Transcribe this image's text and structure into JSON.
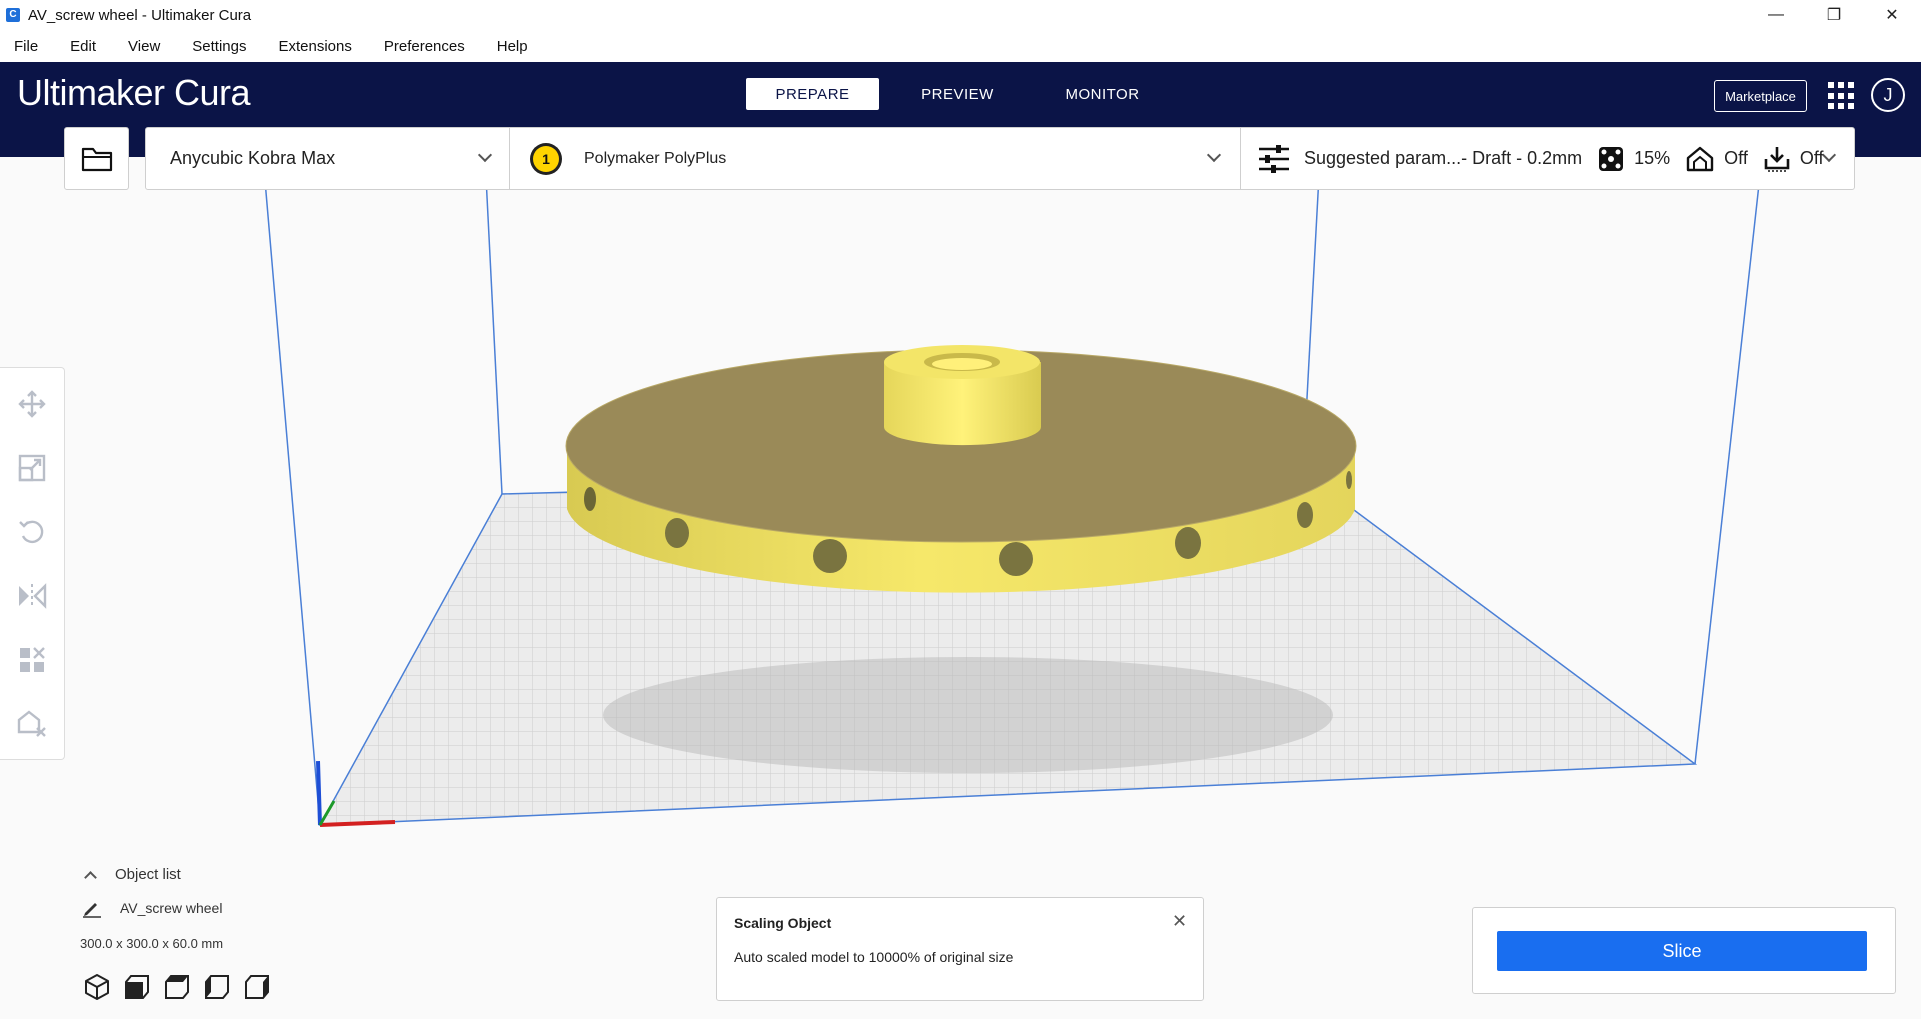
{
  "window": {
    "title": "AV_screw wheel - Ultimaker Cura",
    "app_icon_glyph": "C",
    "controls": {
      "minimize": "—",
      "maximize": "❐",
      "close": "✕"
    }
  },
  "menu": [
    "File",
    "Edit",
    "View",
    "Settings",
    "Extensions",
    "Preferences",
    "Help"
  ],
  "header": {
    "logo_bold": "Ultimaker",
    "logo_light": "Cura",
    "tabs": [
      {
        "label": "PREPARE",
        "active": true
      },
      {
        "label": "PREVIEW",
        "active": false
      },
      {
        "label": "MONITOR",
        "active": false
      }
    ],
    "marketplace": "Marketplace",
    "account_initial": "J"
  },
  "toolbar": {
    "printer": "Anycubic Kobra Max",
    "extruder_number": "1",
    "material": "Polymaker PolyPlus",
    "profile": "Suggested param...- Draft - 0.2mm",
    "infill": "15%",
    "support": "Off",
    "adhesion": "Off"
  },
  "object_list": {
    "toggle_label": "Object list",
    "object_name": "AV_screw wheel",
    "dimensions": "300.0 x 300.0 x 60.0 mm"
  },
  "message": {
    "title": "Scaling Object",
    "body": "Auto scaled model to 10000% of original size",
    "close": "✕"
  },
  "slice_label": "Slice",
  "colors": {
    "header_bg": "#0b1447",
    "accent": "#196ef0",
    "model_top": "#9a8a58",
    "model_side": "#f3e568",
    "extruder": "#ffd400"
  },
  "icons": [
    "move-icon",
    "scale-icon",
    "rotate-icon",
    "mirror-icon",
    "per-model-settings-icon",
    "support-blocker-icon",
    "open-folder-icon",
    "settings-sliders-icon",
    "infill-icon",
    "support-icon",
    "adhesion-icon",
    "edit-pencil-icon",
    "view-3d-icon",
    "view-front-icon",
    "view-top-icon",
    "view-left-icon",
    "view-right-icon"
  ]
}
